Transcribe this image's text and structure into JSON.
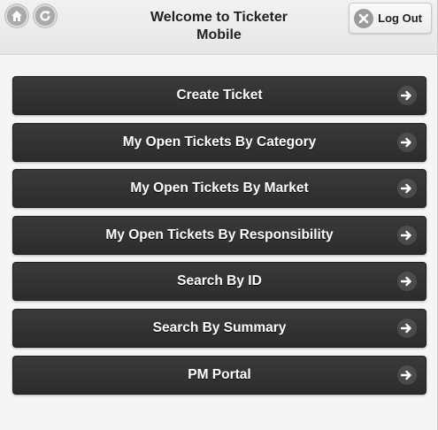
{
  "header": {
    "title_line1": "Welcome to Ticketer",
    "title_line2": "Mobile",
    "logout_label": "Log Out",
    "icons": {
      "home": "home-icon",
      "refresh": "refresh-icon",
      "logout": "close-icon"
    }
  },
  "menu": {
    "items": [
      {
        "label": "Create Ticket"
      },
      {
        "label": "My Open Tickets By Category"
      },
      {
        "label": "My Open Tickets By Market"
      },
      {
        "label": "My Open Tickets By Responsibility"
      },
      {
        "label": "Search By ID"
      },
      {
        "label": "Search By Summary"
      },
      {
        "label": "PM Portal"
      }
    ],
    "item_icon": "arrow-right-icon"
  },
  "colors": {
    "button_bg": "#333333",
    "button_text": "#ffffff",
    "header_bg": "#ececec",
    "page_bg": "#f5f5f5"
  }
}
